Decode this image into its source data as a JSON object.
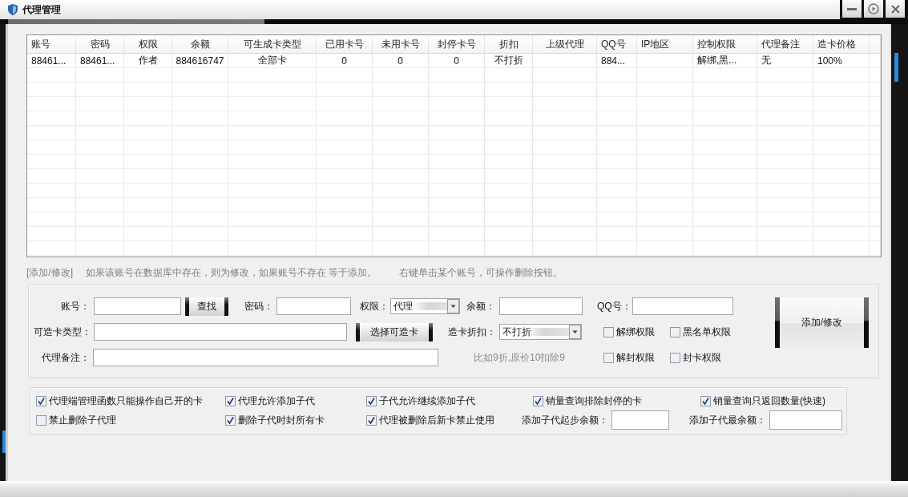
{
  "window": {
    "title": "代理管理"
  },
  "table": {
    "columns": [
      "账号",
      "密码",
      "权限",
      "余额",
      "可生成卡类型",
      "已用卡号",
      "未用卡号",
      "封停卡号",
      "折扣",
      "上级代理",
      "QQ号",
      "IP地区",
      "控制权限",
      "代理备注",
      "造卡价格"
    ],
    "rows": [
      {
        "account": "88461...",
        "password": "88461...",
        "permission": "作者",
        "balance": "884616747",
        "card_types": "全部卡",
        "used_cards": "0",
        "unused_cards": "0",
        "banned_cards": "0",
        "discount": "不打折",
        "qq": "884...",
        "control_rights": "解绑,黑...",
        "remark": "无",
        "card_price": "100%"
      }
    ]
  },
  "notice": [
    "[添加/修改]",
    "如果该账号在数据库中存在，则为修改，如果账号不存在 等于添加。",
    "右键单击某个账号，可操作删除按钮。"
  ],
  "form": {
    "account": {
      "label": "账号："
    },
    "find_button": "查找",
    "password": {
      "label": "密码："
    },
    "permission": {
      "label": "权限：",
      "value": "代理"
    },
    "balance": {
      "label": "余额："
    },
    "qq": {
      "label": "QQ号："
    },
    "card_types": {
      "label": "可造卡类型："
    },
    "choose_button": "选择可造卡",
    "discount": {
      "label": "造卡折扣：",
      "value": "不打折"
    },
    "remark": {
      "label": "代理备注："
    },
    "hint": "比如9折,原价10扣除9",
    "rights": [
      {
        "label": "解绑权限",
        "checked": false
      },
      {
        "label": "黑名单权限",
        "checked": false
      },
      {
        "label": "解封权限",
        "checked": false
      },
      {
        "label": "封卡权限",
        "checked": false
      }
    ],
    "submit_button": "添加/修改"
  },
  "options": {
    "items": [
      {
        "kind": "checkbox",
        "label": "代理端管理函数只能操作自己开的卡",
        "checked": true
      },
      {
        "kind": "checkbox",
        "label": "代理允许添加子代",
        "checked": true
      },
      {
        "kind": "checkbox",
        "label": "子代允许继续添加子代",
        "checked": true
      },
      {
        "kind": "checkbox",
        "label": "销量查询排除封停的卡",
        "checked": true
      },
      {
        "kind": "checkbox",
        "label": "销量查询只返回数量(快速)",
        "checked": true
      },
      {
        "kind": "checkbox",
        "label": "禁止删除子代理",
        "checked": false
      },
      {
        "kind": "checkbox",
        "label": "删除子代时封所有卡",
        "checked": true
      },
      {
        "kind": "checkbox",
        "label": "代理被删除后新卡禁止使用",
        "checked": true
      },
      {
        "kind": "field",
        "label": "添加子代起步余额："
      },
      {
        "kind": "field",
        "label": "添加子代最余额："
      }
    ]
  }
}
